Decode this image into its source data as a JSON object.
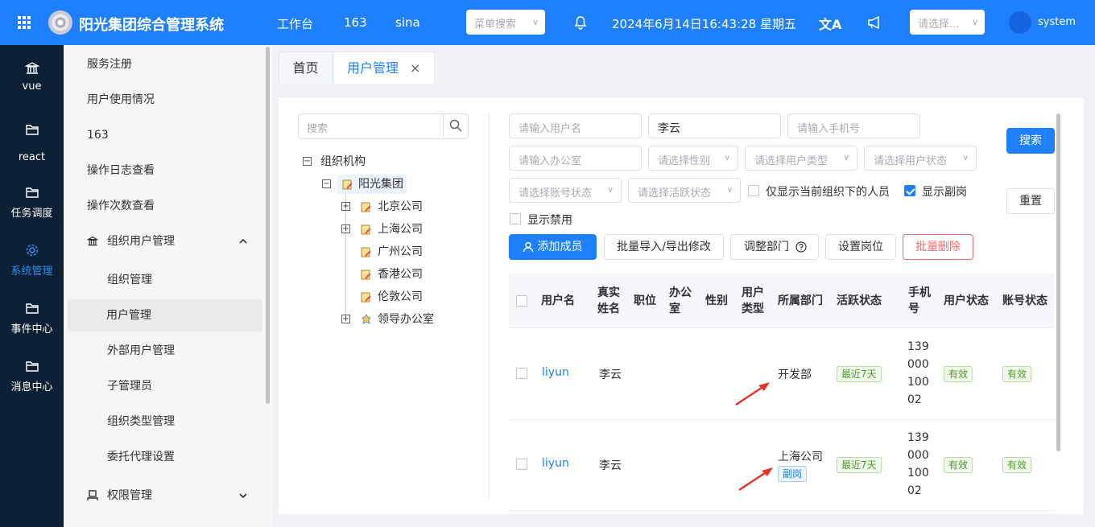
{
  "header": {
    "title": "阳光集团综合管理系统",
    "nav": [
      "工作台",
      "163",
      "sina"
    ],
    "menu_search_placeholder": "菜单搜索",
    "datetime": "2024年6月14日16:43:28 星期五",
    "translate_glyph": "文A",
    "select_placeholder": "请选择...",
    "username": "system"
  },
  "leftbar": {
    "items": [
      {
        "label": "vue",
        "icon": "bank-icon"
      },
      {
        "label": "react",
        "icon": "folder-icon"
      },
      {
        "label": "任务调度",
        "icon": "folder-icon"
      },
      {
        "label": "系统管理",
        "icon": "gear-icon",
        "active": true
      },
      {
        "label": "事件中心",
        "icon": "folder-icon"
      },
      {
        "label": "消息中心",
        "icon": "folder-icon"
      }
    ]
  },
  "submenu": {
    "items": [
      "服务注册",
      "用户使用情况",
      "163",
      "操作日志查看",
      "操作次数查看"
    ],
    "group_label": "组织用户管理",
    "group_items": [
      "组织管理",
      "用户管理",
      "外部用户管理",
      "子管理员",
      "组织类型管理",
      "委托代理设置"
    ],
    "active_item": "用户管理",
    "permission_label": "权限管理"
  },
  "tabs": {
    "home": "首页",
    "user_mgmt": "用户管理",
    "close_glyph": "×"
  },
  "tree": {
    "search_placeholder": "搜索",
    "root": "组织机构",
    "group": "阳光集团",
    "children": [
      "北京公司",
      "上海公司",
      "广州公司",
      "香港公司",
      "伦敦公司",
      "领导办公室"
    ]
  },
  "filters": {
    "username_placeholder": "请输入用户名",
    "realname_value": "李云",
    "phone_placeholder": "请输入手机号",
    "office_placeholder": "请输入办公室",
    "gender_placeholder": "请选择性别",
    "usertype_placeholder": "请选择用户类型",
    "userstatus_placeholder": "请选择用户状态",
    "accountstatus_placeholder": "请选择账号状态",
    "activity_placeholder": "请选择活跃状态",
    "only_current_label": "仅显示当前组织下的人员",
    "show_secondary_label": "显示副岗",
    "show_disabled_label": "显示禁用",
    "search_button": "搜索",
    "reset_button": "重置"
  },
  "actions": {
    "add_member": "添加成员",
    "batch_import": "批量导入/导出修改",
    "adjust_dept": "调整部门",
    "set_post": "设置岗位",
    "batch_delete": "批量删除"
  },
  "table": {
    "headers": [
      "用户名",
      "真实\n姓名",
      "职位",
      "办公\n室",
      "性别",
      "用户\n类型",
      "所属部门",
      "活跃状态",
      "手机\n号",
      "用户状态",
      "账号状态"
    ],
    "rows": [
      {
        "username": "liyun",
        "realname": "李云",
        "dept": "开发部",
        "dept_tag": "",
        "activity": "最近7天",
        "phone": [
          "139",
          "000",
          "100",
          "02"
        ],
        "user_status": "有效",
        "account_status": "有效"
      },
      {
        "username": "liyun",
        "realname": "李云",
        "dept": "上海公司",
        "dept_tag": "副岗",
        "activity": "最近7天",
        "phone": [
          "139",
          "000",
          "100",
          "02"
        ],
        "user_status": "有效",
        "account_status": "有效"
      }
    ]
  },
  "colors": {
    "primary": "#1e80ff",
    "sidebar": "#0c2135",
    "danger": "#f56c6c",
    "arrow": "#e8332b"
  }
}
